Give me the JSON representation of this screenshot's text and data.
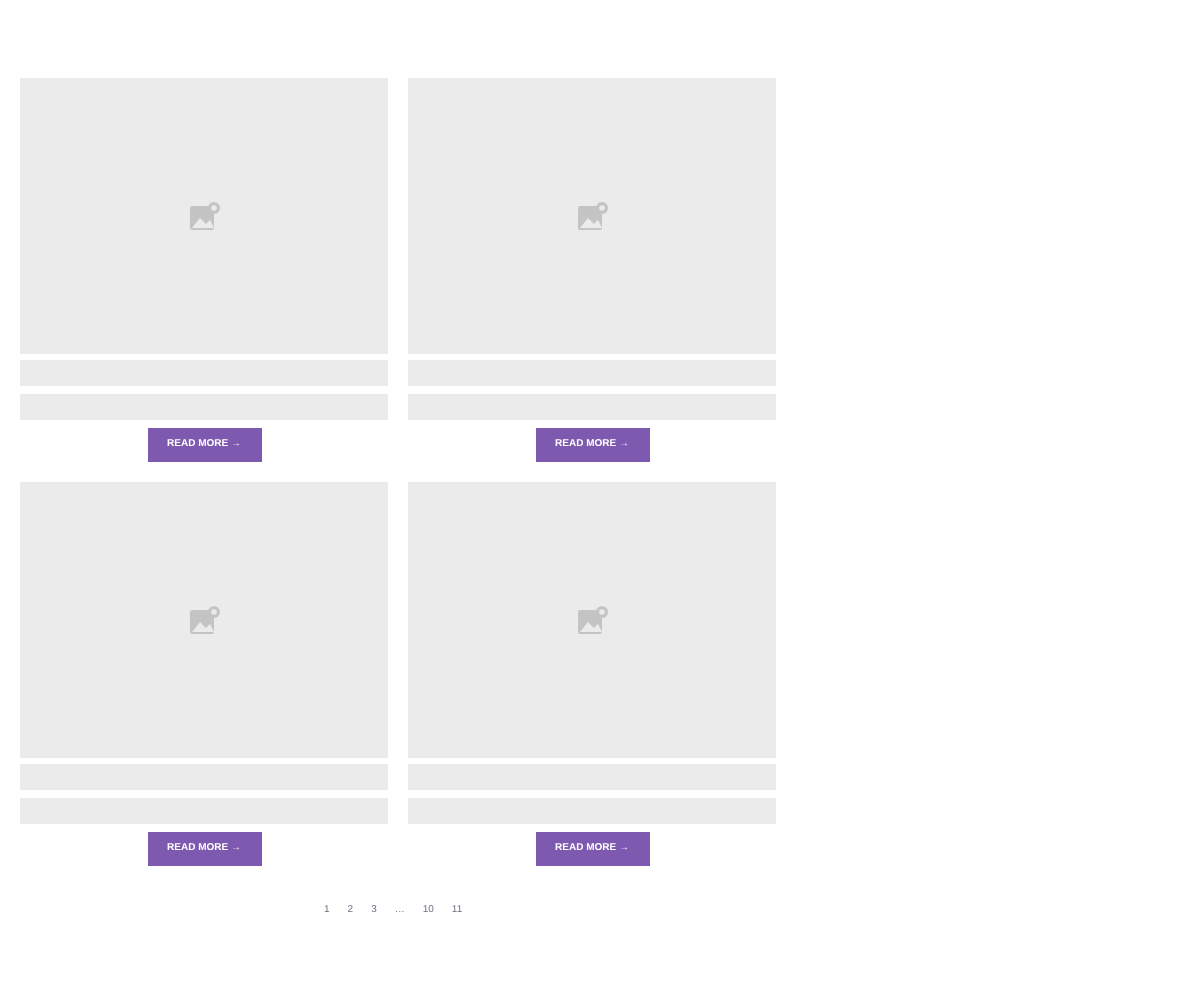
{
  "posts": [
    {
      "button": "READ MORE →"
    },
    {
      "button": "READ MORE →"
    },
    {
      "button": "READ MORE →"
    },
    {
      "button": "READ MORE →"
    }
  ],
  "pagination": [
    "1",
    "2",
    "3",
    "…",
    "10",
    "11"
  ]
}
